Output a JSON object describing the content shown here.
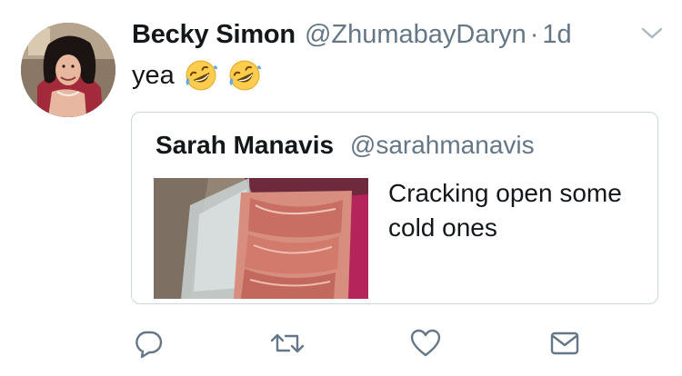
{
  "tweet": {
    "display_name": "Becky Simon",
    "handle": "@ZhumabayDaryn",
    "separator": "·",
    "time": "1d",
    "text": "yea",
    "emojis": [
      "rolling-on-floor-laughing",
      "rolling-on-floor-laughing"
    ]
  },
  "quoted_tweet": {
    "display_name": "Sarah Manavis",
    "handle": "@sarahmanavis",
    "text": "Cracking open some cold ones"
  },
  "icons": {
    "reply": "reply-icon",
    "retweet": "retweet-icon",
    "like": "like-icon",
    "message": "direct-message-icon",
    "caret": "chevron-down-icon"
  },
  "colors": {
    "text": "#14171a",
    "secondary": "#657786",
    "border": "#ccd6dd"
  }
}
